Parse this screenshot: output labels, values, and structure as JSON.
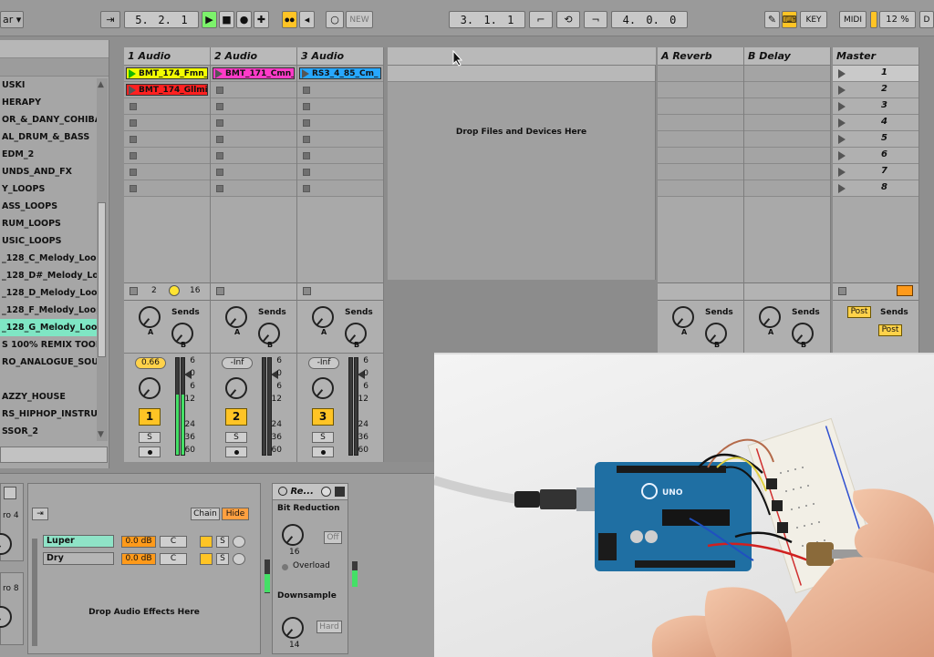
{
  "topbar": {
    "left_label": "ar",
    "arrangement_pos": [
      "5.",
      "2.",
      "1"
    ],
    "loop_start": [
      "3.",
      "1.",
      "1"
    ],
    "loop_length": [
      "4.",
      "0.",
      "0"
    ],
    "new_label": "NEW",
    "key_label": "KEY",
    "midi_label": "MIDI",
    "cpu": "12 %",
    "cut_label": "D"
  },
  "browser": {
    "items": [
      "USKI",
      "HERAPY",
      "OR_&_DANY_COHIBA",
      "AL_DRUM_&_BASS",
      "EDM_2",
      "UNDS_AND_FX",
      "Y_LOOPS",
      "ASS_LOOPS",
      "RUM_LOOPS",
      "USIC_LOOPS",
      "_128_C_Melody_Loop_",
      "_128_D#_Melody_Loop",
      "_128_D_Melody_Loop_",
      "_128_F_Melody_Loop_",
      "_128_G_Melody_Loop_",
      "S 100% REMIX TOOLS",
      "RO_ANALOGUE_SOUI",
      "",
      "AZZY_HOUSE",
      "RS_HIPHOP_INSTRUM",
      "SSOR_2"
    ],
    "selected_index": 14
  },
  "session": {
    "tracks": [
      {
        "name": "1 Audio",
        "clips": [
          {
            "label": "BMT_174_Fmn_",
            "color": "#f2ff00",
            "state": "playing"
          },
          {
            "label": "BMT_174_Gllmi",
            "color": "#ff2020",
            "state": "stopped"
          }
        ],
        "volume": "0.66",
        "number": "1",
        "solo": "S",
        "meter": "green"
      },
      {
        "name": "2 Audio",
        "clips": [
          {
            "label": "BMT_171_Cmn_",
            "color": "#ff3bc8",
            "state": "stopped"
          }
        ],
        "volume": "-Inf",
        "number": "2",
        "solo": "S",
        "meter": "dark"
      },
      {
        "name": "3 Audio",
        "clips": [
          {
            "label": "RS3_4_85_Cm_",
            "color": "#27a7ff",
            "state": "stopped"
          }
        ],
        "volume": "-Inf",
        "number": "3",
        "solo": "S",
        "meter": "dark"
      }
    ],
    "drop_text": "Drop Files and Devices Here",
    "returns": [
      "A Reverb",
      "B Delay"
    ],
    "master": {
      "name": "Master",
      "scenes": [
        "1",
        "2",
        "3",
        "4",
        "5",
        "6",
        "7",
        "8"
      ]
    },
    "io_row": {
      "left": "2",
      "right": "16"
    },
    "sends_label": "Sends",
    "knob_a": "A",
    "knob_b": "B",
    "post_label": "Post",
    "db_scale": [
      "6",
      "0",
      "6",
      "12",
      "24",
      "36",
      "60"
    ]
  },
  "devices": {
    "rack_left_top": "ro 4",
    "rack_left_bottom": "ro 8",
    "chain_label": "Chain",
    "hide_label": "Hide",
    "chains": [
      {
        "name": "Luper",
        "gain": "0.0 dB",
        "pan": "C",
        "solo": "S"
      },
      {
        "name": "Dry",
        "gain": "0.0 dB",
        "pan": "C",
        "solo": "S"
      }
    ],
    "drop_effects": "Drop Audio Effects Here",
    "redux": {
      "title": "Re...",
      "bit_reduction": "Bit Reduction",
      "bits_value": "16",
      "off_label": "Off",
      "overload": "Overload",
      "downsample": "Downsample",
      "downsample_value": "14",
      "hard_label": "Hard"
    }
  },
  "photo": {
    "board_label": "UNO"
  },
  "colors": {
    "accent": "#ffc425",
    "selected_browser": "#7fe6c4",
    "play_green": "#7cf26b"
  }
}
